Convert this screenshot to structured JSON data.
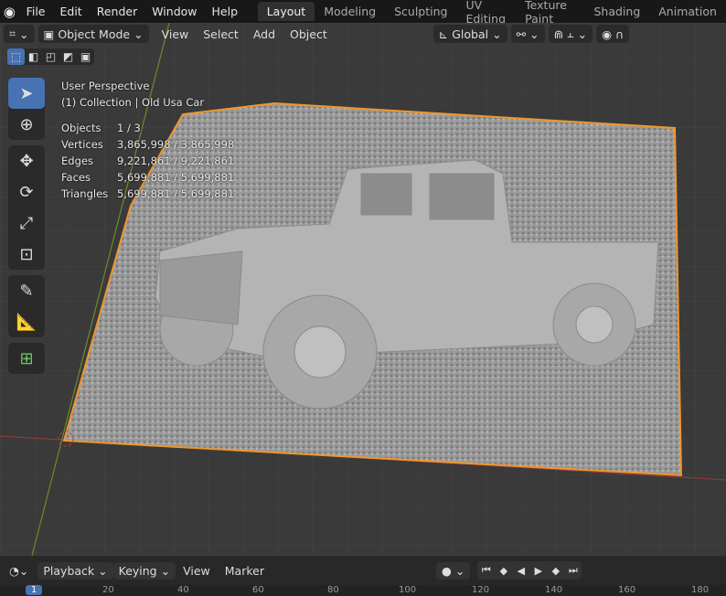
{
  "topbar": {
    "menus": [
      "File",
      "Edit",
      "Render",
      "Window",
      "Help"
    ],
    "workspaces": [
      "Layout",
      "Modeling",
      "Sculpting",
      "UV Editing",
      "Texture Paint",
      "Shading",
      "Animation"
    ],
    "active_workspace": "Layout"
  },
  "viewport_header": {
    "mode": "Object Mode",
    "menus": [
      "View",
      "Select",
      "Add",
      "Object"
    ],
    "orientation": "Global"
  },
  "overlay": {
    "view": "User Perspective",
    "collection": "(1) Collection | Old Usa Car",
    "stats": [
      {
        "label": "Objects",
        "value": "1 / 3"
      },
      {
        "label": "Vertices",
        "value": "3,865,998 / 3,865,998"
      },
      {
        "label": "Edges",
        "value": "9,221,861 / 9,221,861"
      },
      {
        "label": "Faces",
        "value": "5,699,881 / 5,699,881"
      },
      {
        "label": "Triangles",
        "value": "5,699,881 / 5,699,881"
      }
    ]
  },
  "timeline": {
    "menus": [
      "Playback",
      "Keying",
      "View",
      "Marker"
    ],
    "current_frame": "1",
    "ticks": [
      "20",
      "40",
      "60",
      "80",
      "100",
      "120",
      "140",
      "160",
      "180"
    ]
  },
  "colors": {
    "accent": "#4772b3",
    "selection_outline": "#f0962c"
  }
}
